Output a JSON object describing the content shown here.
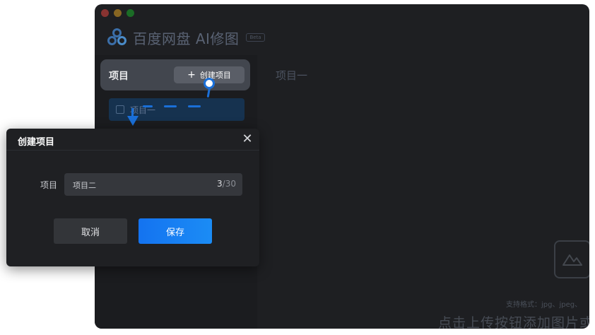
{
  "window": {
    "brand_title": "百度网盘 AI修图",
    "brand_badge": "Beta"
  },
  "sidebar": {
    "panel_title": "项目",
    "create_button": {
      "icon": "plus-icon",
      "label": "创建项目"
    },
    "items": [
      {
        "icon": "image-icon",
        "label": "项目一",
        "selected": true
      }
    ]
  },
  "main": {
    "title": "项目一",
    "upload_icon": "upload-image-icon",
    "format_hint": "支持格式：jpg、jpeg、",
    "upload_hint": "点击上传按钮添加图片或"
  },
  "dialog": {
    "title": "创建项目",
    "close_icon": "close-icon",
    "field_label": "项目",
    "field_value": "项目二",
    "char_count": "3",
    "char_separator": "/",
    "char_max": "30",
    "cancel_label": "取消",
    "save_label": "保存"
  },
  "colors": {
    "accent": "#1a6fd8",
    "save_button": "#1473f0",
    "window_bg": "#1e1f22"
  }
}
